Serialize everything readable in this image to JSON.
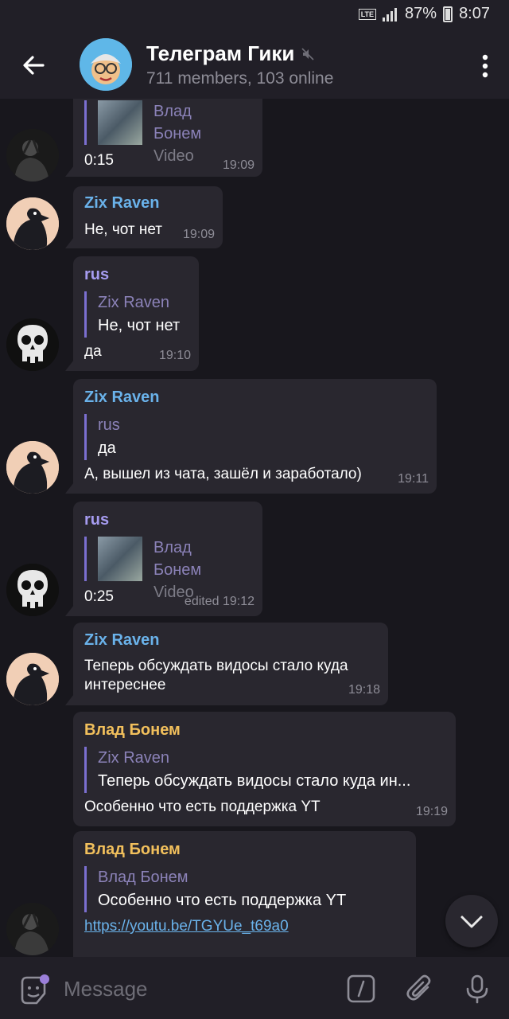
{
  "status": {
    "battery": "87%",
    "time": "8:07",
    "network": "LTE"
  },
  "header": {
    "title": "Телеграм Гики",
    "subtitle": "711 members, 103 online"
  },
  "messages": [
    {
      "reply_name": "Влад Бонем",
      "reply_text": "Video",
      "text": "0:15",
      "time": "19:09"
    },
    {
      "sender": "Zix Raven",
      "text": "Не, чот нет",
      "time": "19:09"
    },
    {
      "sender": "rus",
      "reply_name": "Zix Raven",
      "reply_text": "Не, чот нет",
      "text": "да",
      "time": "19:10"
    },
    {
      "sender": "Zix Raven",
      "reply_name": "rus",
      "reply_text": "да",
      "text": "А, вышел из чата, зашёл и заработало)",
      "time": "19:11"
    },
    {
      "sender": "rus",
      "reply_name": "Влад Бонем",
      "reply_text": "Video",
      "text": "0:25",
      "time": "edited 19:12"
    },
    {
      "sender": "Zix Raven",
      "text_line1": "Теперь обсуждать видосы стало куда",
      "text_line2": "интереснее",
      "time": "19:18"
    },
    {
      "sender": "Влад Бонем",
      "reply_name": "Zix Raven",
      "reply_text": "Теперь обсуждать видосы стало куда ин...",
      "text": "Особенно что есть поддержка YT",
      "time": "19:19"
    },
    {
      "sender": "Влад Бонем",
      "reply_name": "Влад Бонем",
      "reply_text": "Особенно что есть поддержка YT",
      "link": "https://youtu.be/TGYUe_t69a0"
    }
  ],
  "input": {
    "placeholder": "Message"
  },
  "colors": {
    "background": "#18171d",
    "bubble": "#29272f",
    "bar": "#211f27",
    "accent": "#6ab2ea"
  }
}
